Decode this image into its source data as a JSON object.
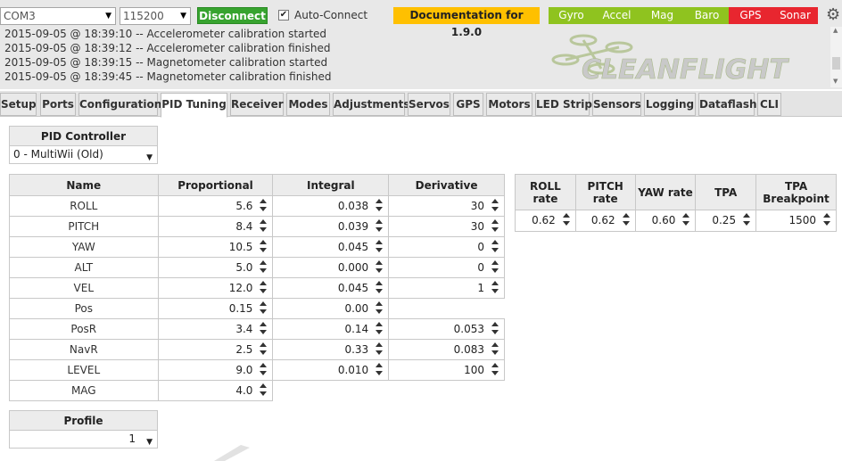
{
  "header": {
    "port": "COM3",
    "baud": "115200",
    "disconnect_label": "Disconnect",
    "auto_connect_label": "Auto-Connect",
    "auto_connect_checked": true,
    "documentation_label": "Documentation for 1.9.0",
    "sensors": [
      {
        "label": "Gyro",
        "color": "#8fc31f"
      },
      {
        "label": "Accel",
        "color": "#8fc31f"
      },
      {
        "label": "Mag",
        "color": "#8fc31f"
      },
      {
        "label": "Baro",
        "color": "#8fc31f"
      },
      {
        "label": "GPS",
        "color": "#e8262f"
      },
      {
        "label": "Sonar",
        "color": "#e8262f"
      }
    ]
  },
  "log": [
    "2015-09-05 @ 18:39:10 -- Accelerometer calibration started",
    "2015-09-05 @ 18:39:12 -- Accelerometer calibration finished",
    "2015-09-05 @ 18:39:15 -- Magnetometer calibration started",
    "2015-09-05 @ 18:39:45 -- Magnetometer calibration finished"
  ],
  "logo_text": "CLEANFLIGHT",
  "tabs": [
    "Setup",
    "Ports",
    "Configuration",
    "PID Tuning",
    "Receiver",
    "Modes",
    "Adjustments",
    "Servos",
    "GPS",
    "Motors",
    "LED Strip",
    "Sensors",
    "Logging",
    "Dataflash",
    "CLI"
  ],
  "active_tab": "PID Tuning",
  "pid_controller": {
    "title": "PID Controller",
    "value": "0 - MultiWii (Old)"
  },
  "pid_table": {
    "headers": [
      "Name",
      "Proportional",
      "Integral",
      "Derivative"
    ],
    "rows": [
      {
        "name": "ROLL",
        "p": "5.6",
        "i": "0.038",
        "d": "30"
      },
      {
        "name": "PITCH",
        "p": "8.4",
        "i": "0.039",
        "d": "30"
      },
      {
        "name": "YAW",
        "p": "10.5",
        "i": "0.045",
        "d": "0"
      },
      {
        "name": "ALT",
        "p": "5.0",
        "i": "0.000",
        "d": "0"
      },
      {
        "name": "VEL",
        "p": "12.0",
        "i": "0.045",
        "d": "1"
      },
      {
        "name": "Pos",
        "p": "0.15",
        "i": "0.00",
        "d": null
      },
      {
        "name": "PosR",
        "p": "3.4",
        "i": "0.14",
        "d": "0.053"
      },
      {
        "name": "NavR",
        "p": "2.5",
        "i": "0.33",
        "d": "0.083"
      },
      {
        "name": "LEVEL",
        "p": "9.0",
        "i": "0.010",
        "d": "100"
      },
      {
        "name": "MAG",
        "p": "4.0",
        "i": null,
        "d": null
      }
    ]
  },
  "rates_table": {
    "headers": [
      "ROLL rate",
      "PITCH rate",
      "YAW rate",
      "TPA",
      "TPA Breakpoint"
    ],
    "values": [
      "0.62",
      "0.62",
      "0.60",
      "0.25",
      "1500"
    ]
  },
  "profile": {
    "title": "Profile",
    "value": "1"
  }
}
